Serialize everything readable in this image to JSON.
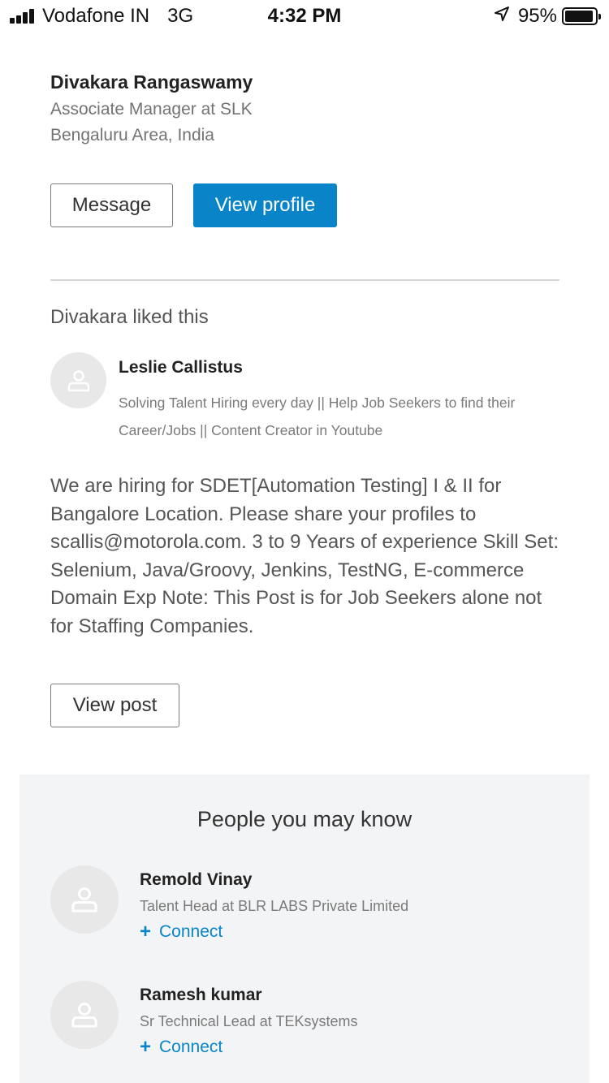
{
  "status_bar": {
    "carrier": "Vodafone IN",
    "network": "3G",
    "time": "4:32 PM",
    "battery": "95%",
    "battery_level": 0.95
  },
  "profile": {
    "name": "Divakara Rangaswamy",
    "headline": "Associate Manager at SLK",
    "location": "Bengaluru Area, India",
    "message_label": "Message",
    "view_profile_label": "View profile"
  },
  "activity": {
    "liked_text": "Divakara liked this",
    "author": {
      "name": "Leslie Callistus",
      "headline": "Solving Talent Hiring every day || Help Job Seekers to find their Career/Jobs || Content Creator in Youtube"
    },
    "post_text": "We are hiring for SDET[Automation Testing] I & II for Bangalore Location. Please share your profiles to scallis@motorola.com.  3 to 9 Years of experience  Skill Set: Selenium, Java/Groovy, Jenkins, TestNG, E-commerce Domain Exp Note: This Post is for Job Seekers alone not for Staffing Companies.",
    "view_post_label": "View post"
  },
  "pymk": {
    "title": "People you may know",
    "people": [
      {
        "name": "Remold Vinay",
        "headline": "Talent Head at BLR LABS Private Limited",
        "connect_label": "Connect"
      },
      {
        "name": "Ramesh kumar",
        "headline": "Sr Technical Lead at TEKsystems",
        "connect_label": "Connect"
      }
    ]
  },
  "colors": {
    "accent": "#0a84c9",
    "pymk_background": "#f3f4f6"
  },
  "icons": {
    "signal": "signal-bars-icon",
    "location": "location-arrow-icon",
    "battery": "battery-icon",
    "avatar": "person-placeholder-icon",
    "connect": "plus-icon"
  }
}
